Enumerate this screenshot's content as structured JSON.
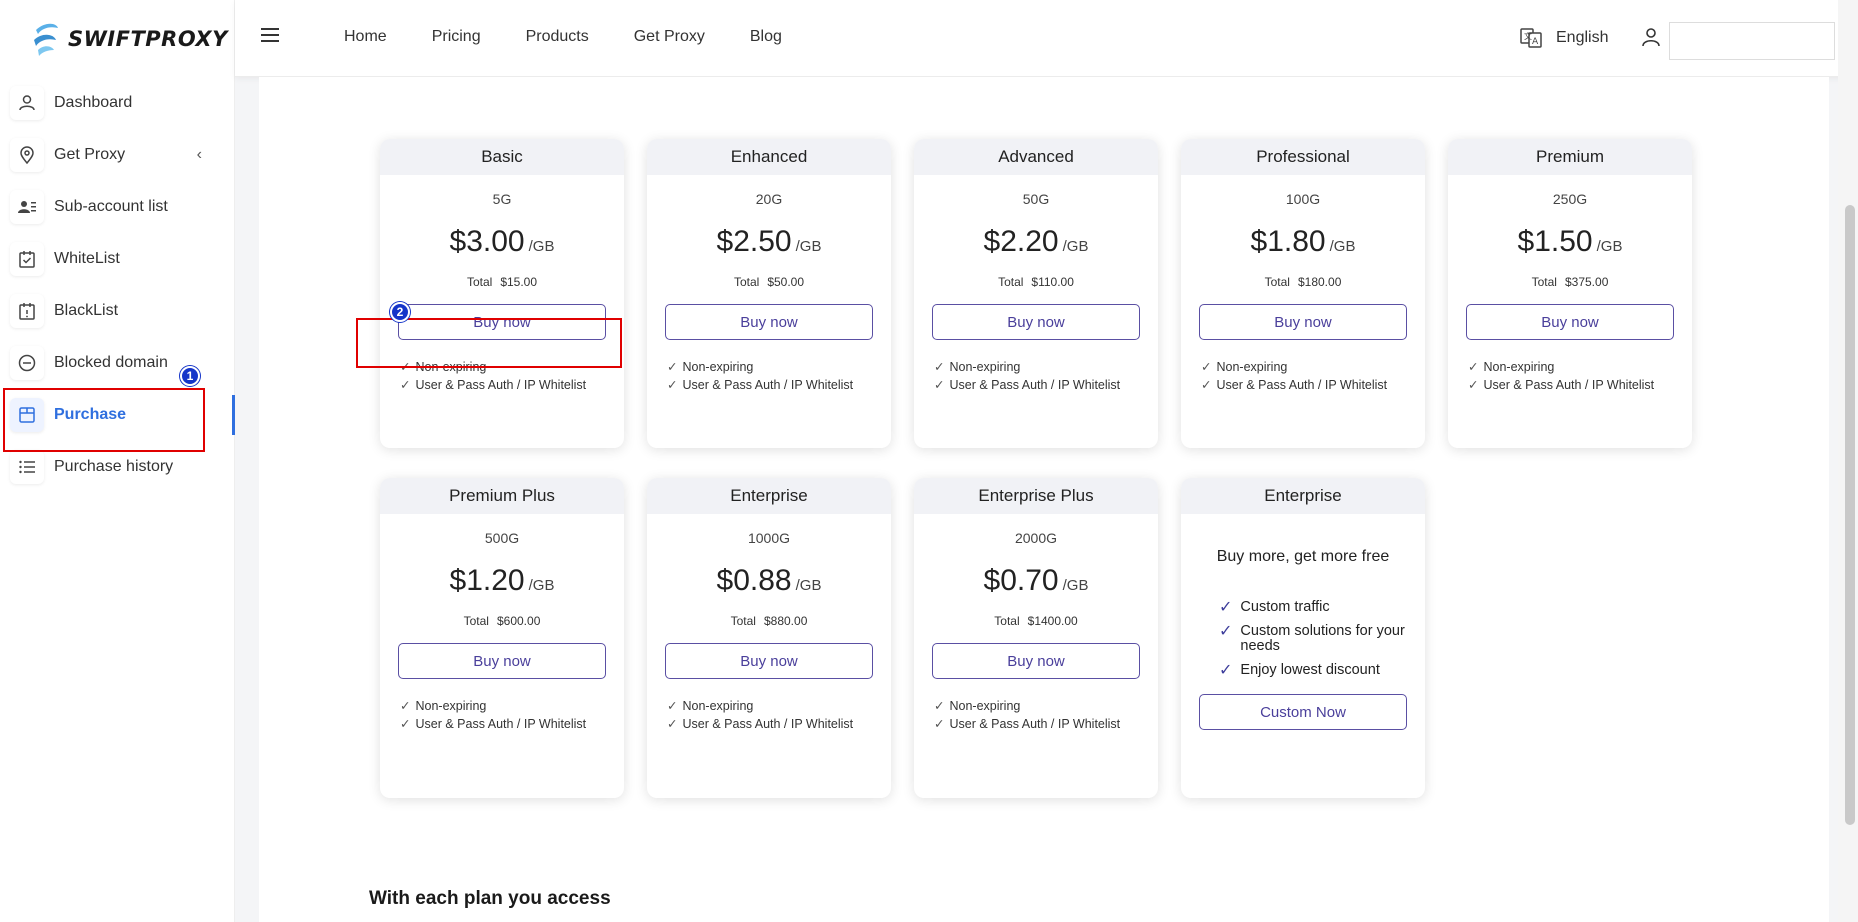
{
  "brand": {
    "name": "SWIFTPROXY"
  },
  "sidebar": {
    "items": [
      {
        "label": "Dashboard",
        "icon": "user-icon"
      },
      {
        "label": "Get Proxy",
        "icon": "location-pin-icon"
      },
      {
        "label": "Sub-account list",
        "icon": "user-list-icon"
      },
      {
        "label": "WhiteList",
        "icon": "calendar-check-icon"
      },
      {
        "label": "BlackList",
        "icon": "calendar-alert-icon"
      },
      {
        "label": "Blocked domain",
        "icon": "minus-circle-icon"
      },
      {
        "label": "Purchase",
        "icon": "store-icon",
        "active": true
      },
      {
        "label": "Purchase history",
        "icon": "list-icon"
      }
    ]
  },
  "header": {
    "nav": [
      "Home",
      "Pricing",
      "Products",
      "Get Proxy",
      "Blog"
    ],
    "language": "English"
  },
  "plans": [
    {
      "name": "Basic",
      "traffic": "5G",
      "price": "$3.00",
      "unit": "/GB",
      "total_label": "Total",
      "total": "$15.00",
      "button": "Buy now"
    },
    {
      "name": "Enhanced",
      "traffic": "20G",
      "price": "$2.50",
      "unit": "/GB",
      "total_label": "Total",
      "total": "$50.00",
      "button": "Buy now"
    },
    {
      "name": "Advanced",
      "traffic": "50G",
      "price": "$2.20",
      "unit": "/GB",
      "total_label": "Total",
      "total": "$110.00",
      "button": "Buy now"
    },
    {
      "name": "Professional",
      "traffic": "100G",
      "price": "$1.80",
      "unit": "/GB",
      "total_label": "Total",
      "total": "$180.00",
      "button": "Buy now"
    },
    {
      "name": "Premium",
      "traffic": "250G",
      "price": "$1.50",
      "unit": "/GB",
      "total_label": "Total",
      "total": "$375.00",
      "button": "Buy now"
    },
    {
      "name": "Premium Plus",
      "traffic": "500G",
      "price": "$1.20",
      "unit": "/GB",
      "total_label": "Total",
      "total": "$600.00",
      "button": "Buy now"
    },
    {
      "name": "Enterprise",
      "traffic": "1000G",
      "price": "$0.88",
      "unit": "/GB",
      "total_label": "Total",
      "total": "$880.00",
      "button": "Buy now"
    },
    {
      "name": "Enterprise Plus",
      "traffic": "2000G",
      "price": "$0.70",
      "unit": "/GB",
      "total_label": "Total",
      "total": "$1400.00",
      "button": "Buy now"
    }
  ],
  "features": [
    "Non-expiring",
    "User & Pass Auth / IP Whitelist"
  ],
  "enterprise_card": {
    "name": "Enterprise",
    "title": "Buy more, get more free",
    "items": [
      "Custom traffic",
      "Custom solutions for your needs",
      "Enjoy lowest discount"
    ],
    "button": "Custom Now"
  },
  "section_title": "With each plan you access",
  "annotations": [
    {
      "number": "1",
      "target": "sidebar-item-purchase"
    },
    {
      "number": "2",
      "target": "basic-buy-button"
    }
  ]
}
